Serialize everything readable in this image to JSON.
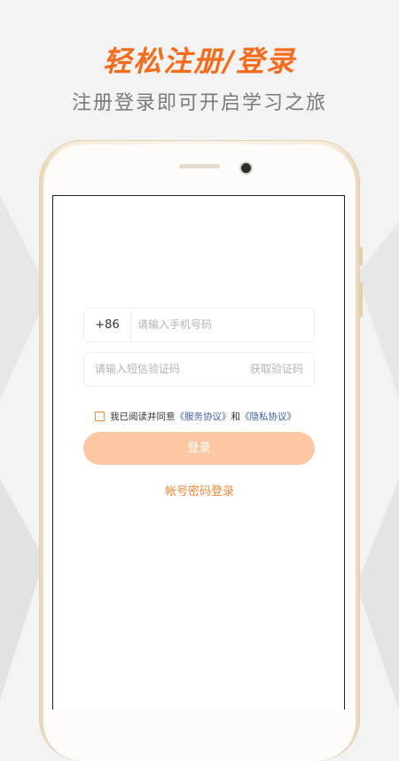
{
  "banner": {
    "headline": "轻松注册/登录",
    "subline": "注册登录即可开启学习之旅"
  },
  "form": {
    "country_code": "+86",
    "phone_placeholder": "请输入手机号码",
    "code_placeholder": "请输入短信验证码",
    "get_code_label": "获取验证码",
    "agree_prefix": "我已阅读并同意",
    "service_link": "《服务协议》",
    "agree_and": "和",
    "privacy_link": "《隐私协议》",
    "login_label": "登录",
    "password_login_label": "帐号密码登录"
  },
  "colors": {
    "accent": "#f46c1c",
    "button_disabled": "#fdc7a2",
    "link": "#3b5ea8"
  }
}
